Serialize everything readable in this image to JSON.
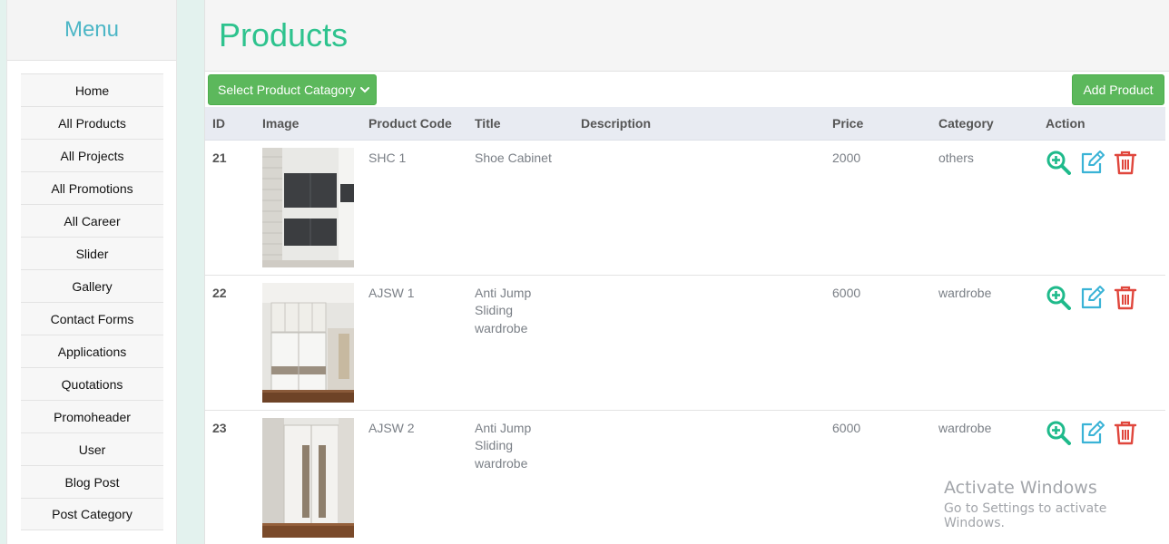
{
  "sidebar": {
    "title": "Menu",
    "items": [
      {
        "label": "Home"
      },
      {
        "label": "All Products"
      },
      {
        "label": "All Projects"
      },
      {
        "label": "All Promotions"
      },
      {
        "label": "All Career"
      },
      {
        "label": "Slider"
      },
      {
        "label": "Gallery"
      },
      {
        "label": "Contact Forms"
      },
      {
        "label": "Applications"
      },
      {
        "label": "Quotations"
      },
      {
        "label": "Promoheader"
      },
      {
        "label": "User"
      },
      {
        "label": "Blog Post"
      },
      {
        "label": "Post Category"
      }
    ]
  },
  "page": {
    "title": "Products",
    "category_select": "Select Product Catagory",
    "add_button": "Add Product"
  },
  "table": {
    "columns": [
      "ID",
      "Image",
      "Product Code",
      "Title",
      "Description",
      "Price",
      "Category",
      "Action"
    ],
    "rows": [
      {
        "id": "21",
        "code": "SHC 1",
        "title": "Shoe Cabinet",
        "description": "",
        "price": "2000",
        "category": "others"
      },
      {
        "id": "22",
        "code": "AJSW 1",
        "title": "Anti Jump Sliding wardrobe",
        "description": "",
        "price": "6000",
        "category": "wardrobe"
      },
      {
        "id": "23",
        "code": "AJSW 2",
        "title": "Anti Jump Sliding wardrobe",
        "description": "",
        "price": "6000",
        "category": "wardrobe"
      }
    ]
  },
  "watermark": {
    "title": "Activate Windows",
    "subtitle": "Go to Settings to activate Windows."
  },
  "colors": {
    "accent_green": "#2ec38e",
    "button_green": "#5cb85c",
    "view_icon": "#1fba8b",
    "edit_icon": "#3ab3d6",
    "delete_icon": "#e0463c"
  },
  "icons": {
    "view": "zoom-in-icon",
    "edit": "edit-icon",
    "delete": "trash-icon"
  }
}
